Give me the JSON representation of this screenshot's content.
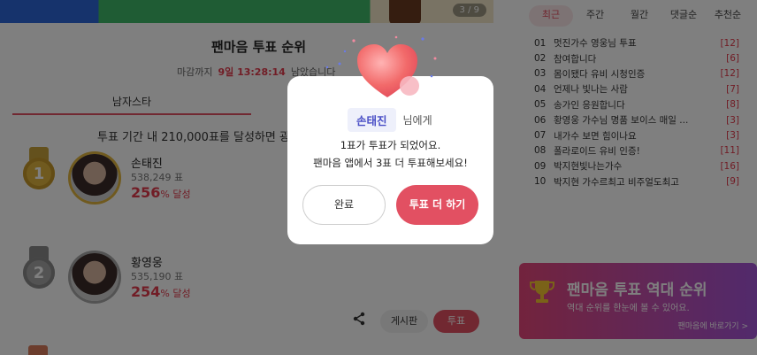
{
  "banner": {
    "counter": "3 / 9"
  },
  "ranking": {
    "title": "팬마음 투표 순위",
    "deadline_label": "마감까지",
    "deadline_time": "9일 13:28:14",
    "deadline_suffix": "남았습니다",
    "tab": "남자스타",
    "notice": "투표 기간 내 210,000표를 달성하면 광",
    "entries": [
      {
        "rank": "1",
        "name": "손태진",
        "votes": "538,249 표",
        "pct": "256",
        "pct_suffix": "% 달성"
      },
      {
        "rank": "2",
        "name": "황영웅",
        "votes": "535,190 표",
        "pct": "254",
        "pct_suffix": "% 달성"
      }
    ],
    "board_label": "게시판",
    "vote_label": "투표"
  },
  "sidebar": {
    "tabs": [
      "최근",
      "주간",
      "월간",
      "댓글순",
      "추천순"
    ],
    "active_tab": "최근",
    "items": [
      {
        "num": "01",
        "title": "멋진가수 영웅님 투표",
        "count": "[12]"
      },
      {
        "num": "02",
        "title": "참여합니다",
        "count": "[6]"
      },
      {
        "num": "03",
        "title": "몸이됐다 유비 시청인증",
        "count": "[12]"
      },
      {
        "num": "04",
        "title": "언제나 빛나는 사람",
        "count": "[7]"
      },
      {
        "num": "05",
        "title": "송가인 응원합니다",
        "count": "[8]"
      },
      {
        "num": "06",
        "title": "황영웅 가수님 명품 보이스 매일 ...",
        "count": "[3]"
      },
      {
        "num": "07",
        "title": "내가수 보면 힘이나요",
        "count": "[3]"
      },
      {
        "num": "08",
        "title": "폴라로이드 유비 인증!",
        "count": "[11]"
      },
      {
        "num": "09",
        "title": "박지현빛나는가수",
        "count": "[16]"
      },
      {
        "num": "10",
        "title": "박지현 가수르최고 비주얼도최고",
        "count": "[9]"
      }
    ],
    "history_title": "팬마음 투표 역대 순위",
    "history_sub": "역대 순위를 한눈에 볼 수 있어요.",
    "history_more": "팬마음에 바로가기 >"
  },
  "modal": {
    "recipient_name": "손태진",
    "recipient_suffix": "님에게",
    "message_line1": "1표가 투표가 되었어요.",
    "message_line2": "팬마음 앱에서 3표 더 투표해보세요!",
    "done_label": "완료",
    "vote_more_label": "투표 더 하기"
  },
  "colors": {
    "accent": "#e25062",
    "chip_text": "#4a4fc6"
  }
}
